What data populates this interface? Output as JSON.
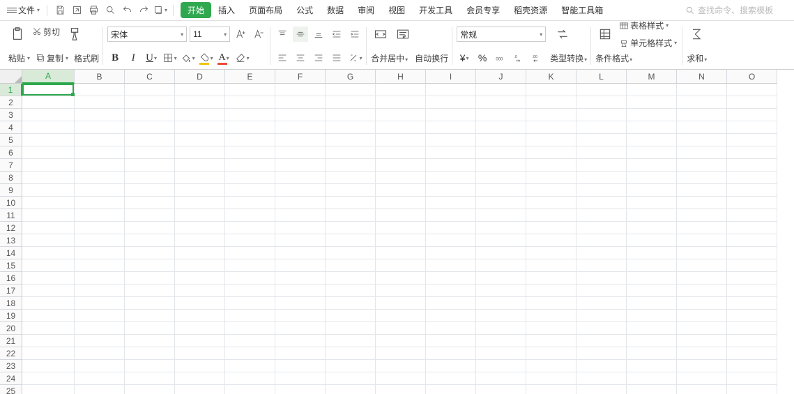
{
  "menu": {
    "file": "文件"
  },
  "tabs": [
    "开始",
    "插入",
    "页面布局",
    "公式",
    "数据",
    "审阅",
    "视图",
    "开发工具",
    "会员专享",
    "稻壳资源",
    "智能工具箱"
  ],
  "search": {
    "placeholder": "查找命令、搜索模板"
  },
  "ribbon": {
    "paste": "粘贴",
    "cut": "剪切",
    "copy": "复制",
    "fmtpaint": "格式刷",
    "font": "宋体",
    "size": "11",
    "bold": "B",
    "italic": "I",
    "underline": "U",
    "merge": "合并居中",
    "wrap": "自动换行",
    "numfmt": "常规",
    "typeconv": "类型转换",
    "condfmt": "条件格式",
    "tblstyle": "表格样式",
    "cellstyle": "单元格样式",
    "sum": "求和"
  },
  "currency": "¥",
  "percent": "%",
  "cols": [
    "A",
    "B",
    "C",
    "D",
    "E",
    "F",
    "G",
    "H",
    "I",
    "J",
    "K",
    "L",
    "M",
    "N",
    "O"
  ],
  "rows": [
    1,
    2,
    3,
    4,
    5,
    6,
    7,
    8,
    9,
    10,
    11,
    12,
    13,
    14,
    15,
    16,
    17,
    18,
    19,
    20,
    21,
    22,
    23,
    24,
    25
  ],
  "selected": {
    "col": "A",
    "row": 1
  }
}
